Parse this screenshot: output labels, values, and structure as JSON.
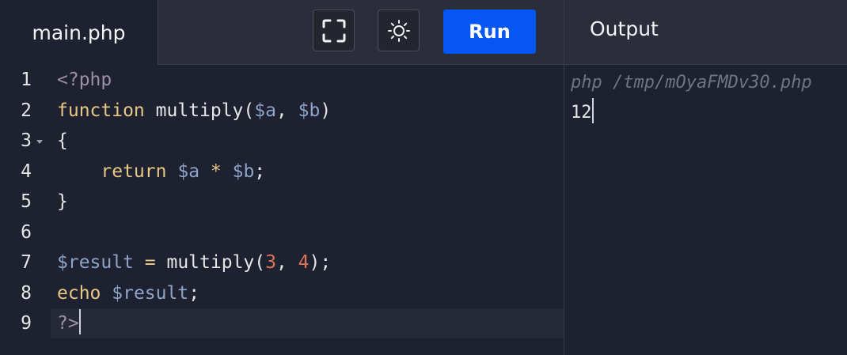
{
  "header": {
    "file_tab": "main.php",
    "run_label": "Run",
    "output_label": "Output",
    "icons": {
      "fullscreen": "fullscreen-icon",
      "theme": "sun-icon"
    }
  },
  "editor": {
    "line_numbers": [
      "1",
      "2",
      "3",
      "4",
      "5",
      "6",
      "7",
      "8",
      "9"
    ],
    "lines": {
      "l1": {
        "open_tag": "<?php"
      },
      "l2": {
        "keyword": "function",
        "name": " multiply(",
        "a": "$a",
        "comma": ", ",
        "b": "$b",
        "close": ")"
      },
      "l3": {
        "brace": "{"
      },
      "l4": {
        "indent": "    ",
        "keyword": "return",
        "sp1": " ",
        "a": "$a",
        "op": " * ",
        "b": "$b",
        "end": ";"
      },
      "l5": {
        "brace": "}"
      },
      "l7": {
        "var": "$result",
        "op": " = ",
        "call": "multiply(",
        "n1": "3",
        "comma": ", ",
        "n2": "4",
        "end": ");"
      },
      "l8": {
        "keyword": "echo",
        "sp": " ",
        "var": "$result",
        "end": ";"
      },
      "l9": {
        "close_tag": "?>"
      }
    }
  },
  "output": {
    "command": "php /tmp/mOyaFMDv30.php",
    "result": "12"
  },
  "colors": {
    "run_button": "#0556f3",
    "keyword": "#e6c785",
    "variable": "#8fa3c9",
    "number": "#e0725a",
    "php_tag": "#9d8fa6"
  }
}
